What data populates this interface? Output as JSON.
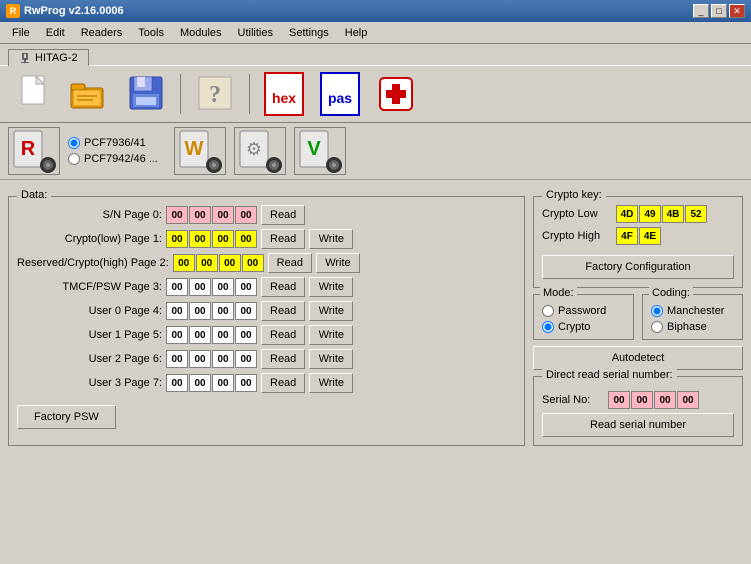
{
  "titleBar": {
    "title": "RwProg  v2.16.0006",
    "icon": "R",
    "minimizeLabel": "_",
    "maximizeLabel": "□",
    "closeLabel": "✕"
  },
  "menuBar": {
    "items": [
      "File",
      "Edit",
      "Readers",
      "Tools",
      "Modules",
      "Utilities",
      "Settings",
      "Help"
    ]
  },
  "tab": {
    "label": "HITAG-2"
  },
  "toolbar": {
    "buttons": [
      {
        "name": "new-file-btn",
        "icon": "📄",
        "label": "New"
      },
      {
        "name": "open-file-btn",
        "icon": "📂",
        "label": "Open"
      },
      {
        "name": "save-file-btn",
        "icon": "💾",
        "label": "Save"
      },
      {
        "name": "help-btn",
        "icon": "❓",
        "label": "Help"
      },
      {
        "name": "hex-btn",
        "iconText": "hex",
        "label": "Hex"
      },
      {
        "name": "pas-btn",
        "iconText": "pas",
        "label": "Password"
      },
      {
        "name": "firstaid-btn",
        "icon": "🧰",
        "label": "First Aid"
      }
    ]
  },
  "radioPanel": {
    "readIcon": "R",
    "options": [
      {
        "label": "PCF7936/41",
        "value": "pcf7936",
        "checked": true
      },
      {
        "label": "PCF7942/46 ...",
        "value": "pcf7942",
        "checked": false
      }
    ],
    "writeIcon": "W",
    "configIcon": "⚙",
    "verifyIcon": "V"
  },
  "dataPanel": {
    "title": "Data:",
    "rows": [
      {
        "label": "S/N Page 0:",
        "bytes": [
          "00",
          "00",
          "00",
          "00"
        ],
        "byteColors": [
          "pink",
          "pink",
          "pink",
          "pink"
        ],
        "showRead": true,
        "showWrite": false
      },
      {
        "label": "Crypto(low) Page 1:",
        "bytes": [
          "00",
          "00",
          "00",
          "00"
        ],
        "byteColors": [
          "yellow",
          "yellow",
          "yellow",
          "yellow"
        ],
        "showRead": true,
        "showWrite": true
      },
      {
        "label": "Reserved/Crypto(high) Page 2:",
        "bytes": [
          "00",
          "00",
          "00",
          "00"
        ],
        "byteColors": [
          "yellow",
          "yellow",
          "yellow",
          "yellow"
        ],
        "showRead": true,
        "showWrite": true
      },
      {
        "label": "TMCF/PSW Page 3:",
        "bytes": [
          "00",
          "00",
          "00",
          "00"
        ],
        "byteColors": [
          "white",
          "white",
          "white",
          "white"
        ],
        "showRead": true,
        "showWrite": true
      },
      {
        "label": "User 0 Page 4:",
        "bytes": [
          "00",
          "00",
          "00",
          "00"
        ],
        "byteColors": [
          "white",
          "white",
          "white",
          "white"
        ],
        "showRead": true,
        "showWrite": true
      },
      {
        "label": "User 1 Page 5:",
        "bytes": [
          "00",
          "00",
          "00",
          "00"
        ],
        "byteColors": [
          "white",
          "white",
          "white",
          "white"
        ],
        "showRead": true,
        "showWrite": true
      },
      {
        "label": "User 2 Page 6:",
        "bytes": [
          "00",
          "00",
          "00",
          "00"
        ],
        "byteColors": [
          "white",
          "white",
          "white",
          "white"
        ],
        "showRead": true,
        "showWrite": true
      },
      {
        "label": "User 3 Page 7:",
        "bytes": [
          "00",
          "00",
          "00",
          "00"
        ],
        "byteColors": [
          "white",
          "white",
          "white",
          "white"
        ],
        "showRead": true,
        "showWrite": true
      }
    ],
    "factoryPswLabel": "Factory PSW",
    "readLabel": "Read",
    "writeLabel": "Write"
  },
  "cryptoPanel": {
    "title": "Crypto key:",
    "cryptoLow": {
      "label": "Crypto Low",
      "bytes": [
        "4D",
        "49",
        "4B",
        "52"
      ],
      "byteColors": [
        "yellow",
        "yellow",
        "yellow",
        "yellow"
      ]
    },
    "cryptoHigh": {
      "label": "Crypto High",
      "bytes": [
        "4F",
        "4E"
      ],
      "byteColors": [
        "yellow",
        "yellow"
      ]
    },
    "factoryConfigLabel": "Factory Configuration"
  },
  "modePanel": {
    "title": "Mode:",
    "options": [
      {
        "label": "Password",
        "value": "password",
        "checked": false
      },
      {
        "label": "Crypto",
        "value": "crypto",
        "checked": true
      }
    ]
  },
  "codingPanel": {
    "title": "Coding:",
    "options": [
      {
        "label": "Manchester",
        "value": "manchester",
        "checked": true
      },
      {
        "label": "Biphase",
        "value": "biphase",
        "checked": false
      }
    ]
  },
  "autodetectLabel": "Autodetect",
  "directReadPanel": {
    "title": "Direct read serial number:",
    "serialLabel": "Serial No:",
    "bytes": [
      "00",
      "00",
      "00",
      "00"
    ],
    "byteColors": [
      "pink",
      "pink",
      "pink",
      "pink"
    ],
    "readSerialLabel": "Read serial number"
  }
}
